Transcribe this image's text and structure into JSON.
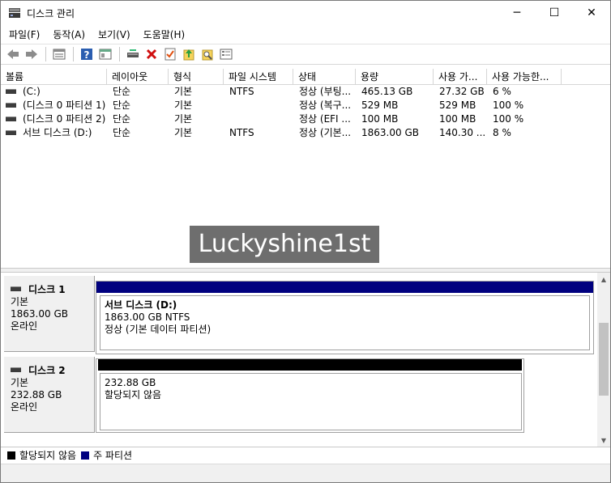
{
  "window": {
    "title": "디스크 관리",
    "controls": {
      "minimize": "─",
      "maximize": "☐",
      "close": "✕"
    }
  },
  "menu": [
    "파일(F)",
    "동작(A)",
    "보기(V)",
    "도움말(H)"
  ],
  "toolbar": {
    "buttons": [
      "back-arrow-icon",
      "forward-arrow-icon",
      "disk-list-icon",
      "help-icon",
      "console-icon",
      "connect-drive-icon",
      "delete-icon",
      "properties-icon",
      "refresh-icon",
      "search-icon",
      "settings-list-icon"
    ]
  },
  "volume_list": {
    "columns": [
      "볼륨",
      "레이아웃",
      "형식",
      "파일 시스템",
      "상태",
      "용량",
      "사용 가...",
      "사용 가능한..."
    ],
    "rows": [
      [
        "(C:)",
        "단순",
        "기본",
        "NTFS",
        "정상 (부팅...",
        "465.13 GB",
        "27.32 GB",
        "6 %"
      ],
      [
        "(디스크 0 파티션 1)",
        "단순",
        "기본",
        "",
        "정상 (복구...",
        "529 MB",
        "529 MB",
        "100 %"
      ],
      [
        "(디스크 0 파티션 2)",
        "단순",
        "기본",
        "",
        "정상 (EFI ...",
        "100 MB",
        "100 MB",
        "100 %"
      ],
      [
        "서브 디스크 (D:)",
        "단순",
        "기본",
        "NTFS",
        "정상 (기본...",
        "1863.00 GB",
        "140.30 ...",
        "8 %"
      ]
    ]
  },
  "watermark": "Luckyshine1st",
  "disks": [
    {
      "name": "디스크 1",
      "type": "기본",
      "size": "1863.00 GB",
      "status": "온라인",
      "partition": {
        "name": "서브 디스크  (D:)",
        "detail": "1863.00 GB NTFS",
        "status": "정상 (기본 데이터 파티션)"
      }
    },
    {
      "name": "디스크 2",
      "type": "기본",
      "size": "232.88 GB",
      "status": "온라인",
      "partition": {
        "name": "",
        "detail": "232.88 GB",
        "status": "할당되지 않음"
      }
    }
  ],
  "legend": [
    {
      "label": "할당되지 않음",
      "color": "#000000"
    },
    {
      "label": "주 파티션",
      "color": "#00007f"
    }
  ],
  "colors": {
    "primary_partition": "#00007f",
    "unallocated": "#000000"
  }
}
